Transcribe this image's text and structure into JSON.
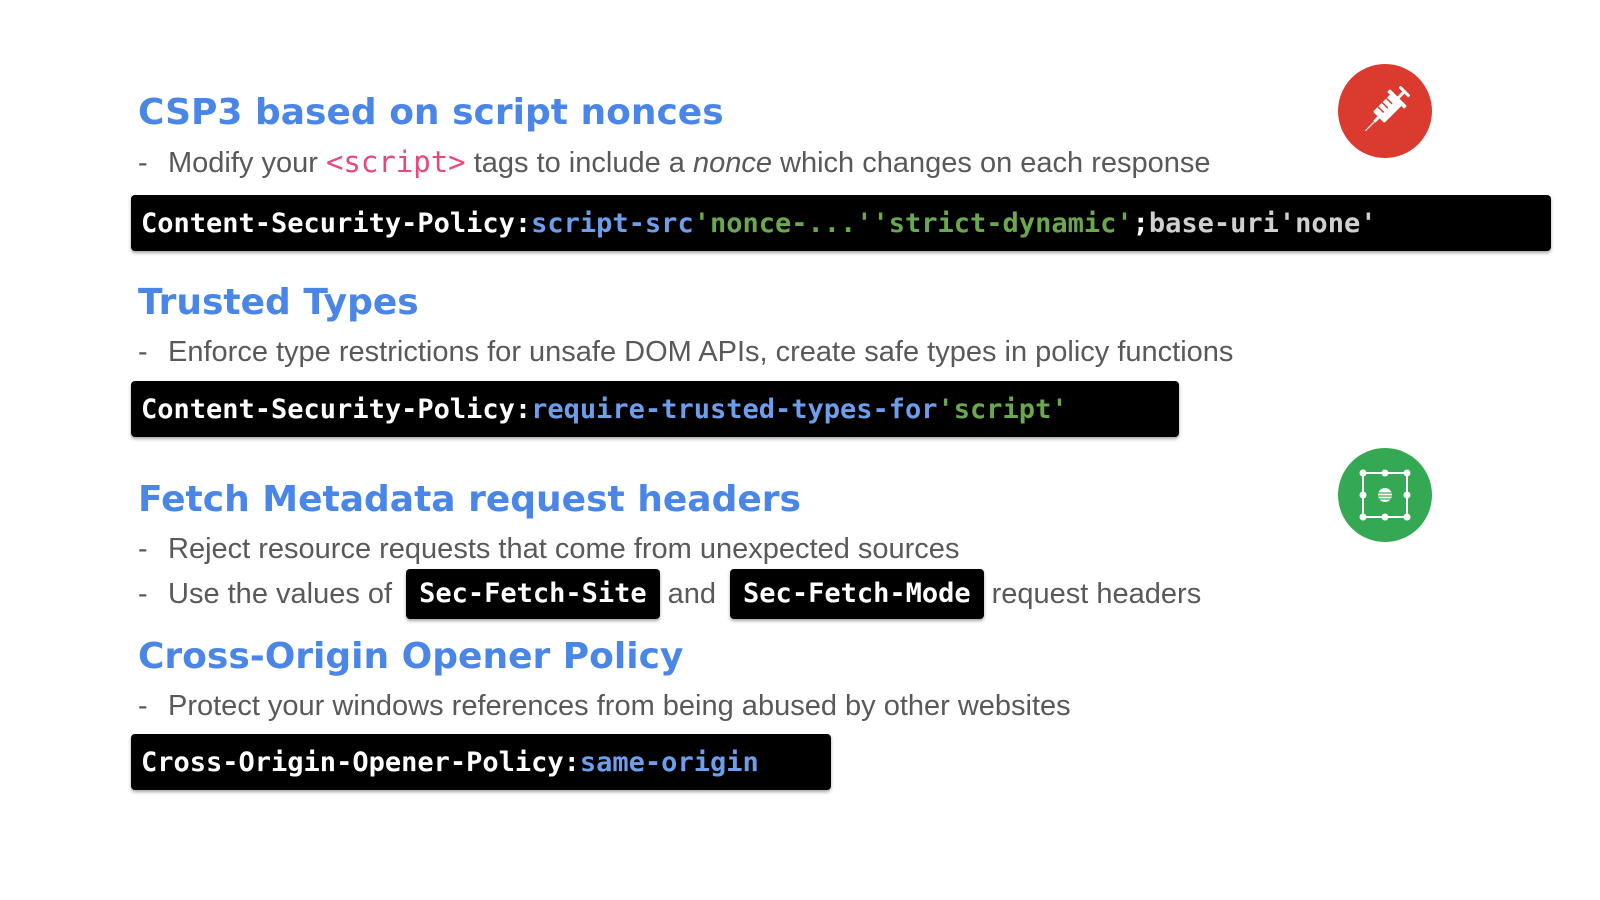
{
  "colors": {
    "heading": "#4a86e8",
    "body_text": "#595959",
    "code_bg": "#000000",
    "code_keyword": "#6d9eeb",
    "code_string": "#6aa84f",
    "code_tag": "#e8487a",
    "icon_red": "#db3a2f",
    "icon_green": "#34a853"
  },
  "icons": {
    "top_right": "syringe-icon",
    "middle_right": "selection-frame-icon"
  },
  "sections": {
    "csp": {
      "heading": "CSP3 based on script nonces",
      "bullet": {
        "dash": "-",
        "text_before": "Modify your ",
        "code_tag": "<script>",
        "text_middle": " tags to include a ",
        "italic_word": "nonce",
        "text_after": " which changes on each response"
      },
      "code": {
        "header": "Content-Security-Policy:",
        "directive": "script-src",
        "nonce": "'nonce-...'",
        "strict_dynamic": "'strict-dynamic'",
        "semicolon": ";",
        "base_uri": "base-uri",
        "none": "'none'"
      }
    },
    "trusted_types": {
      "heading": "Trusted Types",
      "bullet": {
        "dash": "-",
        "text": "Enforce type restrictions for unsafe DOM APIs, create safe types in policy functions"
      },
      "code": {
        "header": "Content-Security-Policy:",
        "directive": "require-trusted-types-for",
        "value": "'script'"
      }
    },
    "fetch_metadata": {
      "heading": "Fetch Metadata request headers",
      "bullet1": {
        "dash": "-",
        "text": "Reject resource requests that come from unexpected sources"
      },
      "bullet2": {
        "dash": "-",
        "text_before": "Use the values of",
        "code1": "Sec-Fetch-Site",
        "text_middle": "and",
        "code2": "Sec-Fetch-Mode",
        "text_after": "request headers"
      }
    },
    "coop": {
      "heading": "Cross-Origin Opener Policy",
      "bullet": {
        "dash": "-",
        "text": "Protect your windows references from being abused by other websites"
      },
      "code": {
        "header": "Cross-Origin-Opener-Policy:",
        "value": "same-origin"
      }
    }
  }
}
